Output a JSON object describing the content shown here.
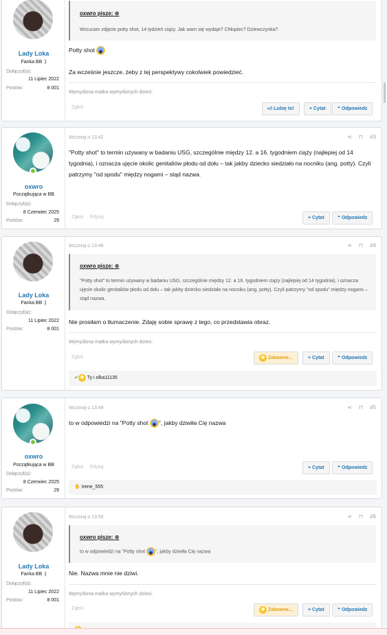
{
  "posts": [
    {
      "user": {
        "name": "Lady Loka",
        "title": "Fanka BB :)",
        "joined_label": "Dołączył(a):",
        "joined": "11 Lipiec 2022",
        "posts_label": "Postów:",
        "posts": "8 001"
      },
      "quote": {
        "author": "oxwro pisze:",
        "text": "Wrzucam zdjęcie potty shot, 14 tydzień ciąży. Jak wam się wydaje? Chłopiec? Dziewczynka?"
      },
      "body1": "Potty shot",
      "body2": "Za wcześnie jeszcze, żeby z tej perspektywy cokolwiek powiedzieć.",
      "signature": "Wymyślona matka wymyślonych dzieci.",
      "report": "Zgłoś",
      "like": "Lubię to!",
      "quote_btn": "+ Cytat",
      "reply": "Odpowiedz"
    },
    {
      "date": "Wczoraj o 13:42",
      "num": "#3",
      "user": {
        "name": "oxwro",
        "title": "Początkująca w BB",
        "joined_label": "Dołączył(a):",
        "joined": "8 Czerwiec 2025",
        "posts_label": "Postów:",
        "posts": "29"
      },
      "body": "\"Potty shot\" to termin używany w badaniu USG, szczególnie między 12. a 16. tygodniem ciąży (najlepiej od 14 tygodnia), i oznacza ujęcie okolic genitaliów płodu od dołu – tak jakby dziecko siedziało na nocniku (ang. potty). Czyli patrzymy \"od spodu\" między nogami – stąd nazwa.",
      "report": "Zgłoś",
      "edit": "Edytuj",
      "quote_btn": "+ Cytat",
      "reply": "Odpowiedz"
    },
    {
      "date": "Wczoraj o 13:48",
      "num": "#4",
      "user": {
        "name": "Lady Loka",
        "title": "Fanka BB :)",
        "joined_label": "Dołączył(a):",
        "joined": "11 Lipiec 2022",
        "posts_label": "Postów:",
        "posts": "8 001"
      },
      "quote": {
        "author": "oxwro pisze:",
        "text": "\"Potty shot\" to termin używany w badaniu USG, szczególnie między 12. a 16. tygodniem ciąży (najlepiej od 14 tygodnia), i oznacza ujęcie okolic genitaliów płodu od dołu – tak jakby dziecko siedziało na nocniku (ang. potty). Czyli patrzymy \"od spodu\" między nogami – stąd nazwa."
      },
      "body": "Nie prosiłam o tłumaczenie. Zdaję sobie sprawę z tego, co przedstawia obraz.",
      "signature": "Wymyślona matka wymyślonych dzieci.",
      "report": "Zgłoś",
      "reaction_btn": "Zabawne...",
      "quote_btn": "+ Cytat",
      "reply": "Odpowiedz",
      "reactions": "Ty i olka11135"
    },
    {
      "date": "Wczoraj o 13:49",
      "num": "#5",
      "user": {
        "name": "oxwro",
        "title": "Początkująca w BB",
        "joined_label": "Dołączył(a):",
        "joined": "8 Czerwiec 2025",
        "posts_label": "Postów:",
        "posts": "29"
      },
      "body_pre": "to w odpowiedzi na \"Potty shot",
      "body_post": "\", jakby dziwiła Cię nazwa",
      "report": "Zgłoś",
      "edit": "Edytuj",
      "quote_btn": "+ Cytat",
      "reply": "Odpowiedz",
      "reactions": "Irene_555"
    },
    {
      "date": "Wczoraj o 13:56",
      "num": "#6",
      "user": {
        "name": "Lady Loka",
        "title": "Fanka BB :)",
        "joined_label": "Dołączył(a):",
        "joined": "11 Lipiec 2022",
        "posts_label": "Postów:",
        "posts": "8 001"
      },
      "quote": {
        "author": "oxwro pisze:",
        "text_pre": "to w odpowiedzi na \"Potty shot",
        "text_post": "\", jakby dziwiła Cię nazwa"
      },
      "body": "Nie. Nazwa mnie nie dziwi.",
      "signature": "Wymyślona matka wymyślonych dzieci.",
      "report": "Zgłoś",
      "reaction_btn": "Zabawne...",
      "quote_btn": "+ Cytat",
      "reply": "Odpowiedz"
    }
  ]
}
